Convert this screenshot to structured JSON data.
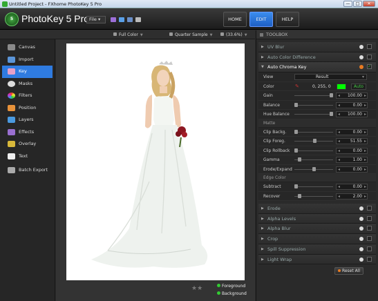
{
  "window": {
    "title": "Untitled Project - FXhome PhotoKey 5 Pro",
    "min": "—",
    "max": "□",
    "close": "✕"
  },
  "app": {
    "logo_text": "5",
    "name": "PhotoKey 5 Pro",
    "file_menu": "File ▾"
  },
  "tabs": [
    {
      "label": "HOME"
    },
    {
      "label": "EDIT"
    },
    {
      "label": "HELP"
    }
  ],
  "options": {
    "color_mode": "Full Color",
    "sample": "Quarter Sample",
    "zoom": "(33.6%)"
  },
  "sidebar": {
    "items": [
      {
        "label": "Canvas"
      },
      {
        "label": "Import"
      },
      {
        "label": "Key"
      },
      {
        "label": "Masks"
      },
      {
        "label": "Filters"
      },
      {
        "label": "Position"
      },
      {
        "label": "Layers"
      },
      {
        "label": "Effects"
      },
      {
        "label": "Overlay"
      },
      {
        "label": "Text"
      },
      {
        "label": "Batch Export"
      }
    ]
  },
  "layers": {
    "foreground": "Foreground",
    "background": "Background"
  },
  "toolbox": {
    "title": "TOOLBOX",
    "sections_top": [
      {
        "label": "UV Blur"
      },
      {
        "label": "Auto Color Difference"
      }
    ],
    "open_section": "Auto Chroma Key",
    "view": {
      "label": "View",
      "value": "Result"
    },
    "color": {
      "label": "Color",
      "value": "0, 255, 0",
      "swatch": "#00ff00",
      "auto": "Auto"
    },
    "params1": [
      {
        "label": "Gain",
        "value": "100.00",
        "pos": 1.0
      },
      {
        "label": "Balance",
        "value": "0.00",
        "pos": 0.0
      },
      {
        "label": "Hue Balance",
        "value": "100.00",
        "pos": 1.0
      }
    ],
    "matte_label": "Matte",
    "matte": [
      {
        "label": "Clip Backg.",
        "value": "0.00",
        "pos": 0.0
      },
      {
        "label": "Clip Foreg.",
        "value": "51.55",
        "pos": 0.52
      },
      {
        "label": "Clip Rollback",
        "value": "0.00",
        "pos": 0.0
      },
      {
        "label": "Gamma",
        "value": "1.00",
        "pos": 0.1
      },
      {
        "label": "Erode/Expand",
        "value": "0.00",
        "pos": 0.5
      }
    ],
    "edge_label": "Edge Color",
    "edge": [
      {
        "label": "Subtract",
        "value": "0.00",
        "pos": 0.0
      },
      {
        "label": "Recover",
        "value": "2.00",
        "pos": 0.1
      }
    ],
    "sections_bottom": [
      {
        "label": "Erode"
      },
      {
        "label": "Alpha Levels"
      },
      {
        "label": "Alpha Blur"
      },
      {
        "label": "Crop"
      },
      {
        "label": "Spill Suppression"
      },
      {
        "label": "Light Wrap"
      }
    ],
    "reset_all": "Reset All"
  }
}
